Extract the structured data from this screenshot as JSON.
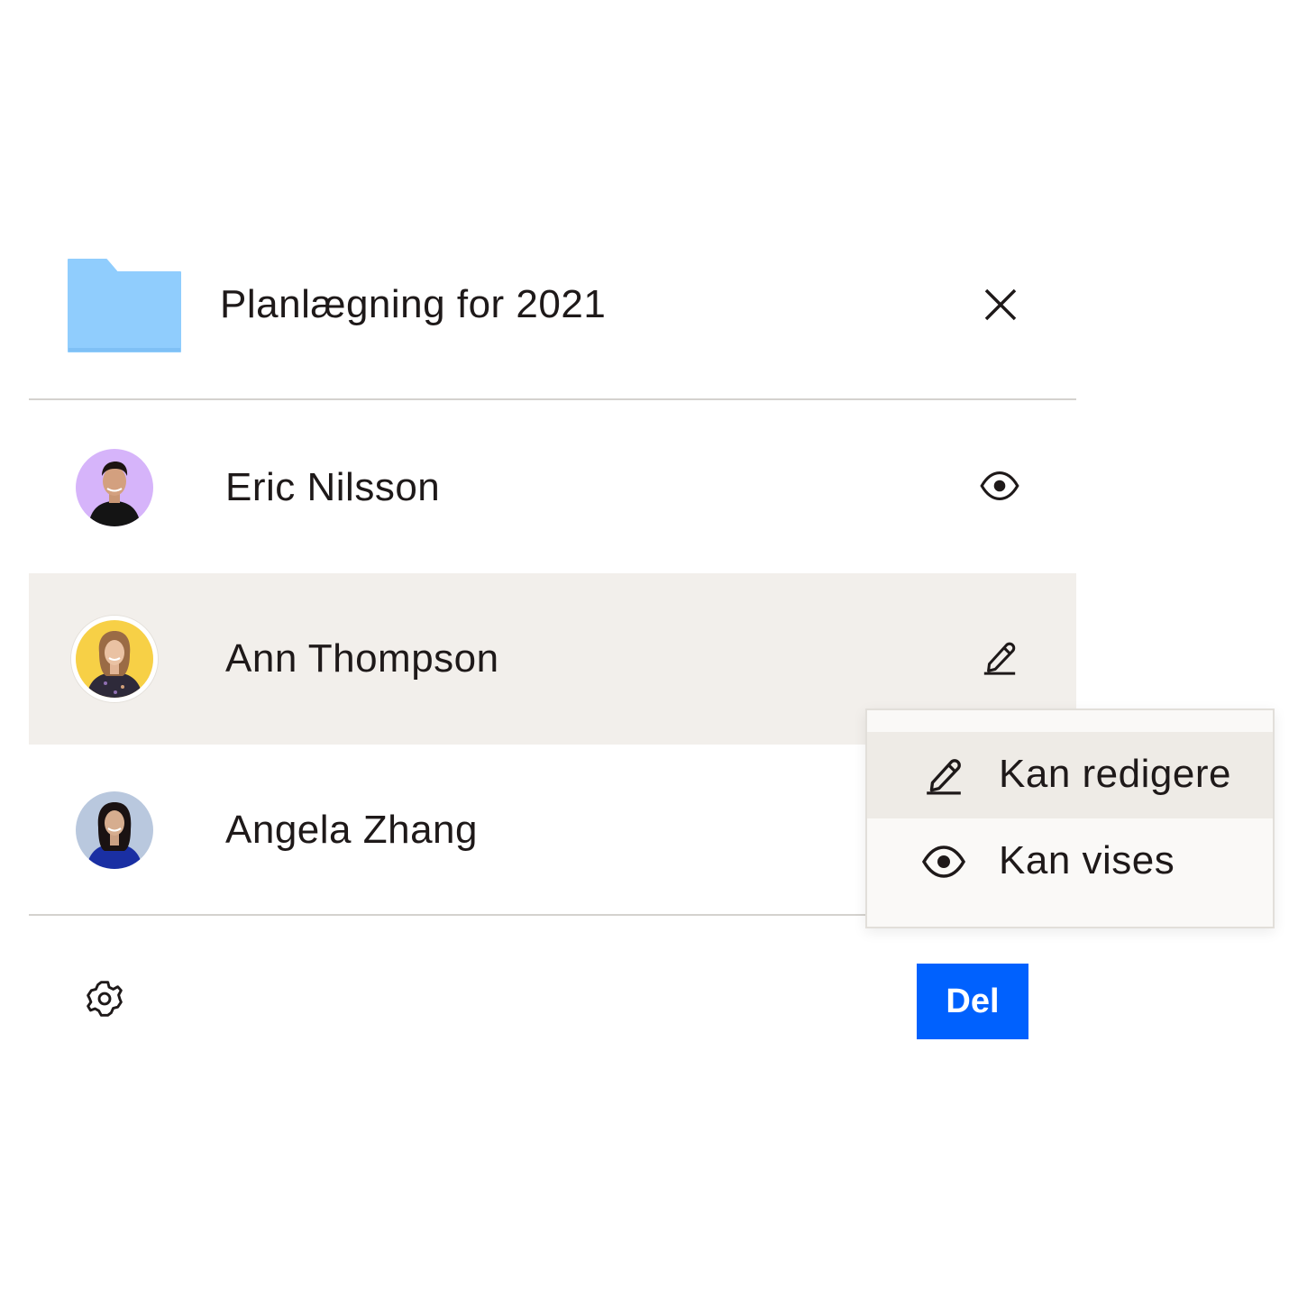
{
  "folder": {
    "title": "Planlægning for 2021",
    "icon": "folder-icon",
    "color": "#90cdfd"
  },
  "header": {
    "close_icon": "close-icon"
  },
  "members": [
    {
      "name": "Eric Nilsson",
      "permission_icon": "eye-icon",
      "avatar_bg": "#d6b4fa",
      "highlighted": false
    },
    {
      "name": "Ann Thompson",
      "permission_icon": "pencil-icon",
      "avatar_bg": "#f7d046",
      "highlighted": true
    },
    {
      "name": "Angela Zhang",
      "permission_icon": "",
      "avatar_bg": "#b9c8de",
      "highlighted": false
    }
  ],
  "permission_menu": {
    "items": [
      {
        "label": "Kan redigere",
        "icon": "pencil-icon",
        "selected": true
      },
      {
        "label": "Kan vises",
        "icon": "eye-icon",
        "selected": false
      }
    ]
  },
  "footer": {
    "settings_icon": "gear-icon",
    "share_label": "Del",
    "share_color": "#0061fe"
  },
  "colors": {
    "highlight_row": "#f2efeb",
    "divider": "#d4d2ce",
    "text": "#1e1919"
  }
}
